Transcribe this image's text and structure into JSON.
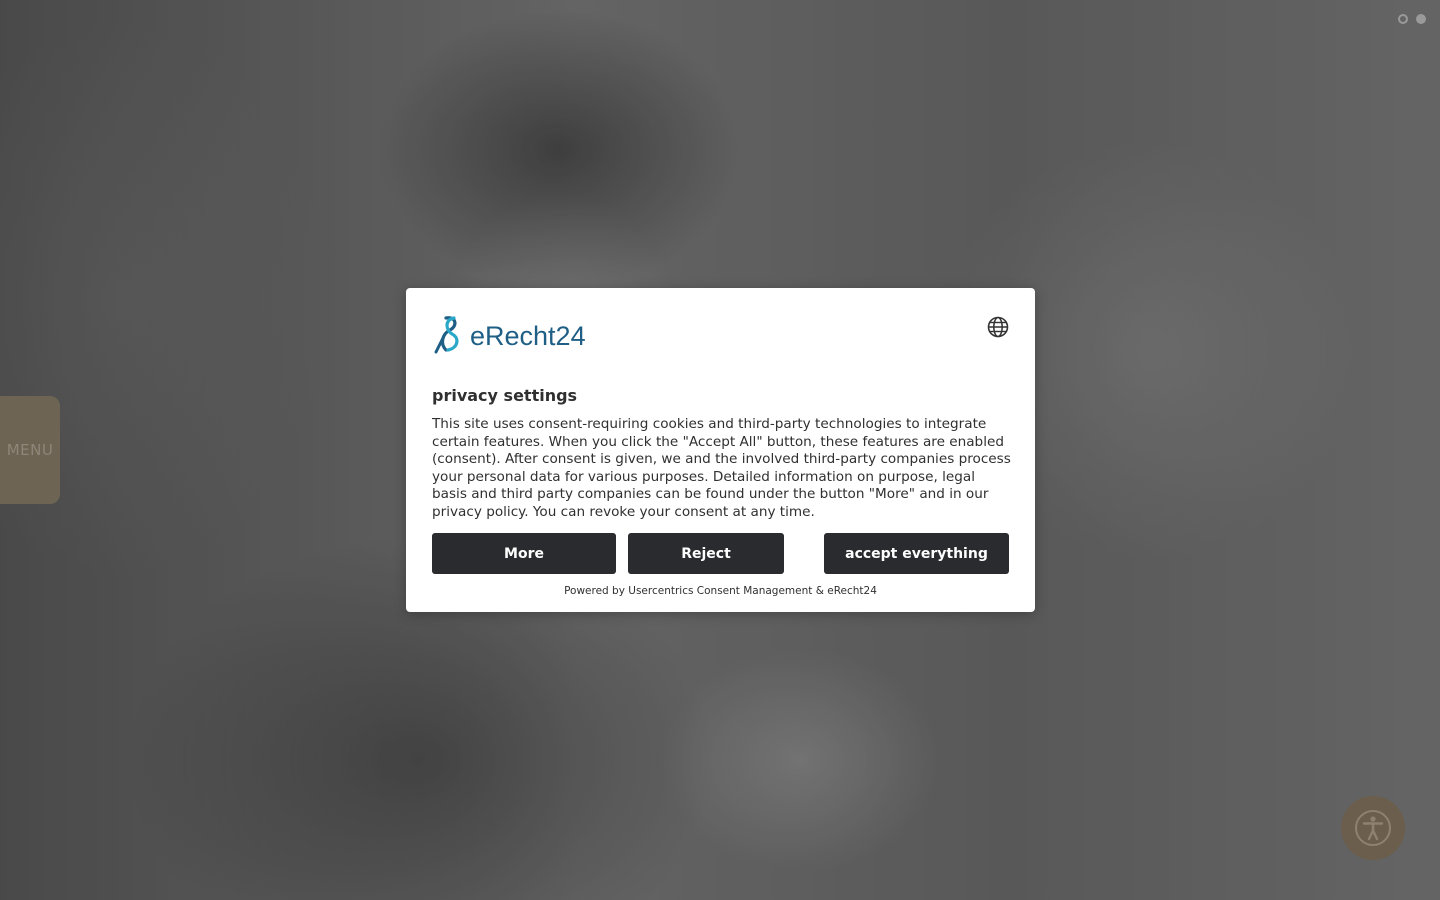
{
  "menu": {
    "label": "MENU"
  },
  "slider": {
    "dots": 2,
    "active_index": 1
  },
  "consent": {
    "logo_text": "eRecht24",
    "title": "privacy settings",
    "body": "This site uses consent-requiring cookies and third-party technologies to integrate certain features. When you click the \"Accept All\" button, these features are enabled (consent). After consent is given, we and the involved third-party companies process your personal data for various purposes. Detailed information on purpose, legal basis and third party companies can be found under the button \"More\" and in our privacy policy. You can revoke your consent at any time.",
    "buttons": {
      "more": "More",
      "reject": "Reject",
      "accept": "accept everything"
    },
    "powered_by": "Powered by Usercentrics Consent Management & eRecht24",
    "language_icon": "globe-icon"
  },
  "accessibility": {
    "icon": "accessibility-icon"
  },
  "colors": {
    "button_bg": "#2a2b2e",
    "logo_blue": "#1f5f86",
    "menu_tab": "#6e6454",
    "a11y_button": "#6c5e4c"
  }
}
